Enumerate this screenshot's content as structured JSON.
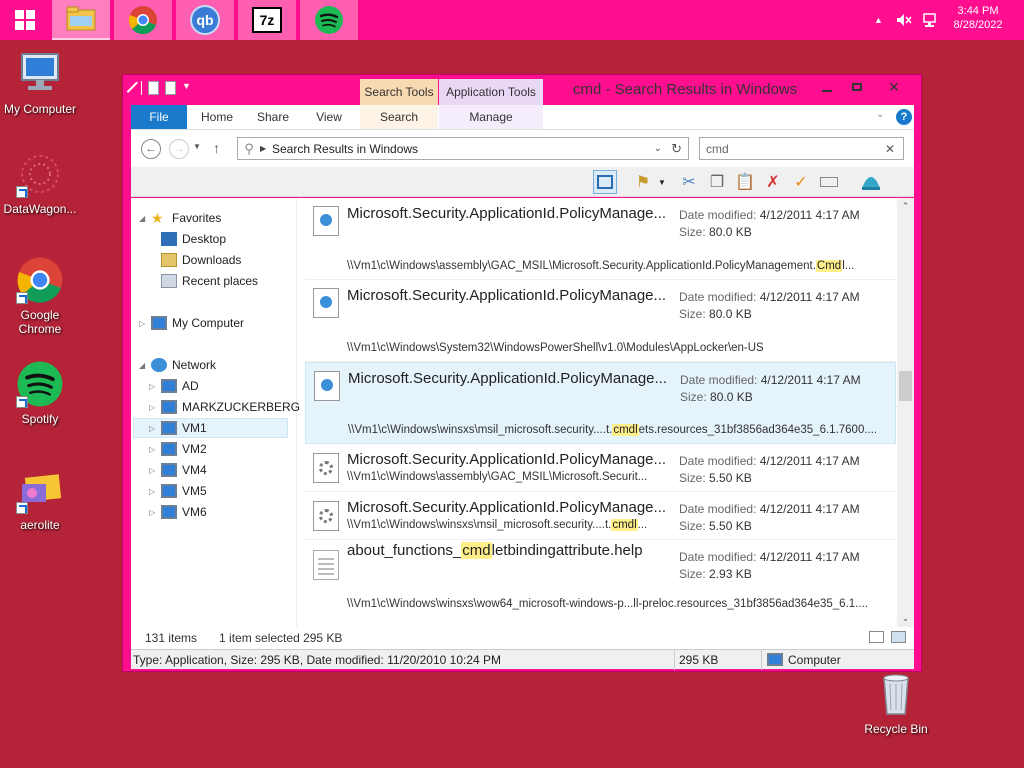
{
  "taskbar": {
    "apps": [
      {
        "name": "file-explorer"
      },
      {
        "name": "chrome"
      },
      {
        "name": "qbittorrent",
        "label": "qb"
      },
      {
        "name": "7zip",
        "label": "7z"
      },
      {
        "name": "spotify"
      }
    ],
    "clock": {
      "time": "3:44 PM",
      "date": "8/28/2022"
    }
  },
  "desktop": {
    "icons": [
      {
        "label": "My Computer"
      },
      {
        "label": "DataWagon..."
      },
      {
        "label": "Google Chrome"
      },
      {
        "label": "Spotify"
      },
      {
        "label": "aerolite"
      },
      {
        "label": "Recycle Bin"
      }
    ]
  },
  "window": {
    "title": "cmd - Search Results in Windows",
    "context_tabs": {
      "search_tools": "Search Tools",
      "application_tools": "Application Tools"
    },
    "ribbon_tabs": [
      "File",
      "Home",
      "Share",
      "View",
      "Search",
      "Manage"
    ],
    "address": "Search Results in Windows",
    "search_value": "cmd",
    "nav": {
      "favorites": "Favorites",
      "desktop": "Desktop",
      "downloads": "Downloads",
      "recent": "Recent places",
      "my_computer": "My Computer",
      "network": "Network",
      "computers": [
        "AD",
        "MARKZUCKERBERG",
        "VM1",
        "VM2",
        "VM4",
        "VM5",
        "VM6"
      ]
    },
    "date_label": "Date modified:",
    "size_label": "Size:",
    "results": [
      {
        "name": "Microsoft.Security.ApplicationId.PolicyManage...",
        "date": "4/12/2011 4:17 AM",
        "size": "80.0 KB",
        "path_pre": "\\\\Vm1\\c\\Windows\\assembly\\GAC_MSIL\\Microsoft.Security.ApplicationId.PolicyManagement.",
        "path_mark": "Cmd",
        "path_post": "l..."
      },
      {
        "name": "Microsoft.Security.ApplicationId.PolicyManage...",
        "date": "4/12/2011 4:17 AM",
        "size": "80.0 KB",
        "path_pre": "\\\\Vm1\\c\\Windows\\System32\\WindowsPowerShell\\v1.0\\Modules\\AppLocker\\en-US",
        "path_mark": "",
        "path_post": ""
      },
      {
        "name": "Microsoft.Security.ApplicationId.PolicyManage...",
        "date": "4/12/2011 4:17 AM",
        "size": "80.0 KB",
        "path_pre": "\\\\Vm1\\c\\Windows\\winsxs\\msil_microsoft.security....t.",
        "path_mark": "cmdl",
        "path_post": "ets.resources_31bf3856ad364e35_6.1.7600...."
      },
      {
        "name": "Microsoft.Security.ApplicationId.PolicyManage...",
        "date": "4/12/2011 4:17 AM",
        "size": "5.50 KB",
        "path_pre": "\\\\Vm1\\c\\Windows\\assembly\\GAC_MSIL\\Microsoft.Securit...",
        "path_mark": "",
        "path_post": ""
      },
      {
        "name": "Microsoft.Security.ApplicationId.PolicyManage...",
        "date": "4/12/2011 4:17 AM",
        "size": "5.50 KB",
        "path_pre": "\\\\Vm1\\c\\Windows\\winsxs\\msil_microsoft.security....t.",
        "path_mark": "cmdl",
        "path_post": "..."
      },
      {
        "name_pre": "about_functions_",
        "name_mark": "cmd",
        "name_post": "letbindingattribute.help",
        "date": "4/12/2011 4:17 AM",
        "size": "2.93 KB",
        "path_pre": "\\\\Vm1\\c\\Windows\\winsxs\\wow64_microsoft-windows-p...ll-preloc.resources_31bf3856ad364e35_6.1....",
        "path_mark": "",
        "path_post": ""
      }
    ],
    "status": {
      "count": "131 items",
      "selected": "1 item selected  295 KB"
    },
    "details_bar": {
      "info": "Type: Application, Size: 295 KB, Date modified: 11/20/2010 10:24 PM",
      "size": "295 KB",
      "location": "Computer"
    }
  },
  "colors": {
    "accent": "#ff0f8f",
    "desktop": "#b52338",
    "file_tab": "#1979ca",
    "highlight": "#ffef8a"
  }
}
